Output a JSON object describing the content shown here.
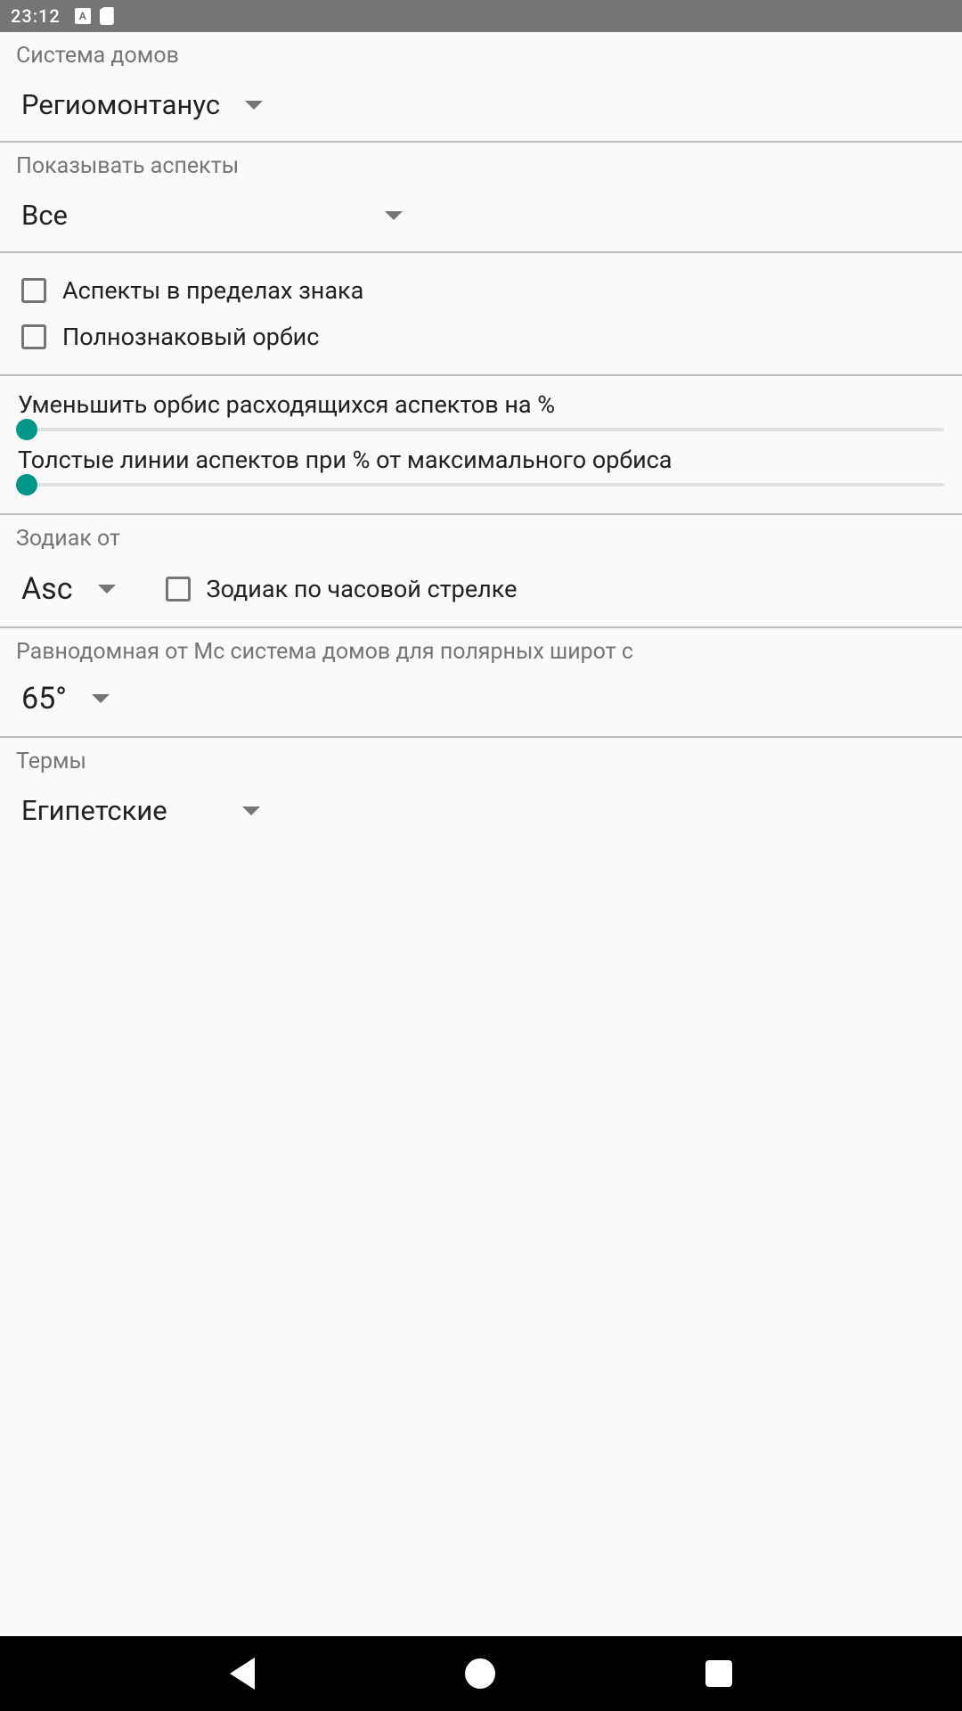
{
  "status": {
    "time": "23:12",
    "keyboard_indicator": "A"
  },
  "house_system": {
    "label": "Система домов",
    "value": "Региомонтанус"
  },
  "show_aspects": {
    "label": "Показывать аспекты",
    "value": "Все"
  },
  "checkboxes": {
    "within_sign": "Аспекты в пределах знака",
    "whole_sign_orb": "Полнознаковый орбис"
  },
  "sliders": {
    "reduce_orb": "Уменьшить орбис расходящихся аспектов на %",
    "thick_lines": "Толстые линии аспектов при % от максимального орбиса"
  },
  "zodiac_from": {
    "label": "Зодиак от",
    "value": "Asc",
    "clockwise_label": "Зодиак по часовой стрелке"
  },
  "polar": {
    "label": "Равнодомная от Mc система домов для полярных широт с",
    "value": "65°"
  },
  "terms": {
    "label": "Термы",
    "value": "Египетские"
  }
}
